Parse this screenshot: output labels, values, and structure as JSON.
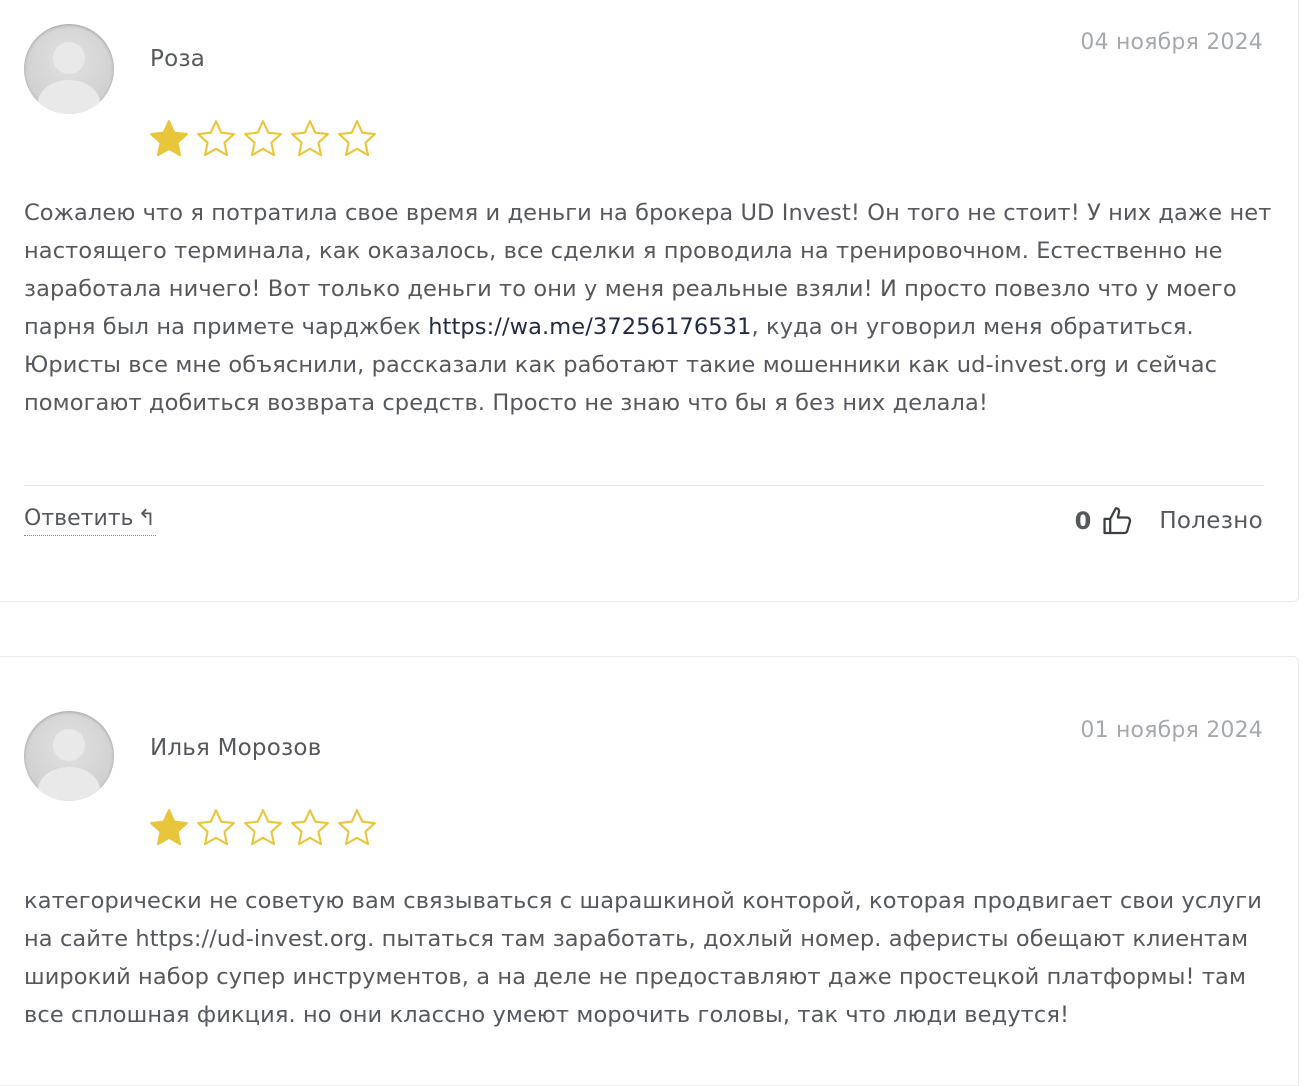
{
  "reviews": [
    {
      "author": "Роза",
      "date": "04 ноября 2024",
      "rating": 1,
      "rating_max": 5,
      "text_before_link": "Сожалею что я потратила свое время и деньги на брокера UD Invest! Он того не стоит! У них даже нет настоящего терминала, как оказалось, все сделки я проводила на тренировочном. Естественно не заработала ничего! Вот только деньги то они у меня реальные взяли! И просто повезло что у моего парня был на примете чарджбек ",
      "link": "https://wa.me/37256176531",
      "text_after_link": ", куда он уговорил меня обратиться. Юристы все мне объяснили, рассказали как работают такие мошенники как ud-invest.org и сейчас помогают добиться возврата средств. Просто не знаю что бы я без них делала!",
      "reply_label": "Ответить",
      "reply_icon": "reply-arrow-icon",
      "likes": "0",
      "helpful_label": "Полезно"
    },
    {
      "author": "Илья Морозов",
      "date": "01 ноября 2024",
      "rating": 1,
      "rating_max": 5,
      "text": "категорически не советую вам связываться с шарашкиной конторой, которая продвигает свои услуги на сайте https://ud-invest.org. пытаться там заработать, дохлый номер. аферисты обещают клиентам широкий набор супер инструментов, а на деле не предоставляют даже простецкой платформы! там все сплошная фикция. но они классно умеют морочить головы, так что люди ведутся!"
    }
  ],
  "colors": {
    "star": "#e9c53b",
    "text": "#55595e",
    "date": "#a5a9ae",
    "link": "#1f2a44"
  }
}
